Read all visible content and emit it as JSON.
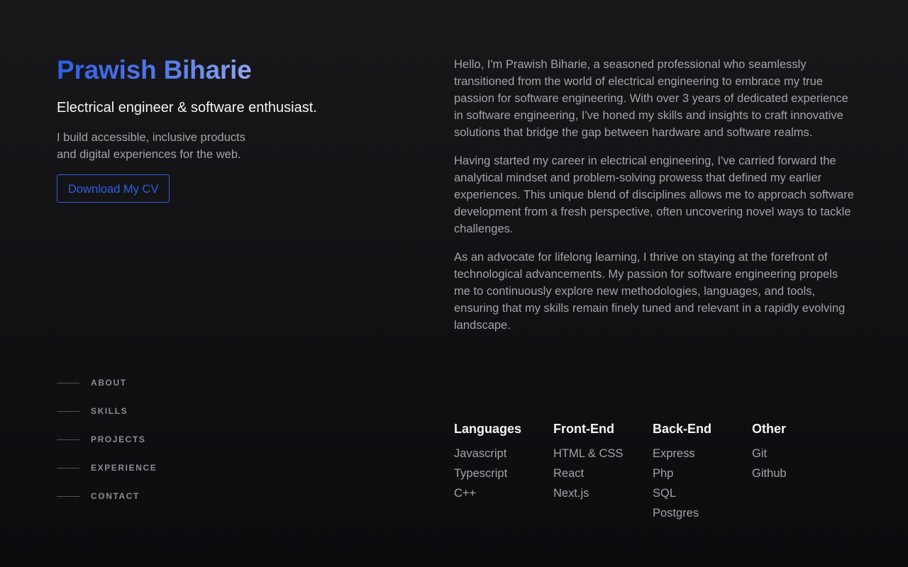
{
  "header": {
    "name": "Prawish Biharie",
    "tagline": "Electrical engineer & software enthusiast.",
    "intro_line1": "I build accessible, inclusive products",
    "intro_line2": "and digital experiences for the web.",
    "cv_button": "Download My CV"
  },
  "nav": {
    "items": [
      {
        "label": "ABOUT"
      },
      {
        "label": "SKILLS"
      },
      {
        "label": "PROJECTS"
      },
      {
        "label": "EXPERIENCE"
      },
      {
        "label": "CONTACT"
      }
    ]
  },
  "about": {
    "paragraphs": [
      "Hello, I'm Prawish Biharie, a seasoned professional who seamlessly transitioned from the world of electrical engineering to embrace my true passion for software engineering. With over 3 years of dedicated experience in software engineering, I've honed my skills and insights to craft innovative solutions that bridge the gap between hardware and software realms.",
      "Having started my career in electrical engineering, I've carried forward the analytical mindset and problem-solving prowess that defined my earlier experiences. This unique blend of disciplines allows me to approach software development from a fresh perspective, often uncovering novel ways to tackle challenges.",
      "As an advocate for lifelong learning, I thrive on staying at the forefront of technological advancements. My passion for software engineering propels me to continuously explore new methodologies, languages, and tools, ensuring that my skills remain finely tuned and relevant in a rapidly evolving landscape."
    ]
  },
  "skills": {
    "categories": [
      {
        "title": "Languages",
        "items": [
          "Javascript",
          "Typescript",
          "C++"
        ]
      },
      {
        "title": "Front-End",
        "items": [
          "HTML & CSS",
          "React",
          "Next.js"
        ]
      },
      {
        "title": "Back-End",
        "items": [
          "Express",
          "Php",
          "SQL",
          "Postgres"
        ]
      },
      {
        "title": "Other",
        "items": [
          "Git",
          "Github"
        ]
      }
    ]
  },
  "colors": {
    "accent": "#2f5fe0",
    "background": "#111114",
    "heading": "#f4f4f5",
    "body_text": "#a1a1aa"
  }
}
